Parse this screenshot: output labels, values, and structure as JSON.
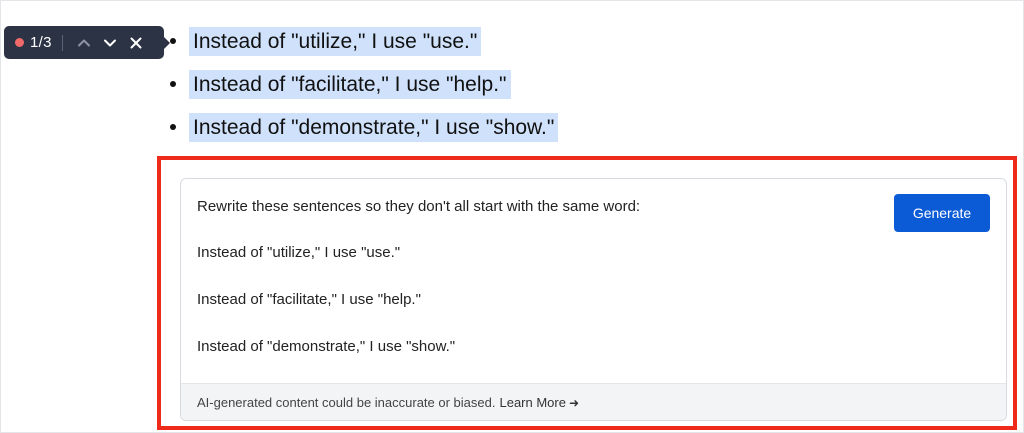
{
  "finder": {
    "count": "1/3",
    "dot_color": "#f06a6a",
    "icons": [
      "chevron-up-icon",
      "chevron-down-icon",
      "close-icon"
    ]
  },
  "bullets": [
    {
      "text": "Instead of \"utilize,\" I use \"use.\""
    },
    {
      "text": "Instead of \"facilitate,\" I use \"help.\""
    },
    {
      "text": "Instead of \"demonstrate,\" I use \"show.\""
    }
  ],
  "card": {
    "prompt": "Rewrite these sentences so they don't all start with the same word:",
    "lines": [
      "Instead of \"utilize,\" I use \"use.\"",
      "Instead of \"facilitate,\" I use \"help.\"",
      "Instead of \"demonstrate,\" I use \"show.\""
    ],
    "generate_label": "Generate",
    "footer_text": "AI-generated content could be inaccurate or biased.",
    "learn_more": "Learn More",
    "learn_more_icon": "arrow-right-icon"
  },
  "colors": {
    "highlight": "#cfe1fb",
    "accent": "#0b5bd7",
    "annotation": "#ee2a1a",
    "toolbar": "#2c3345"
  }
}
